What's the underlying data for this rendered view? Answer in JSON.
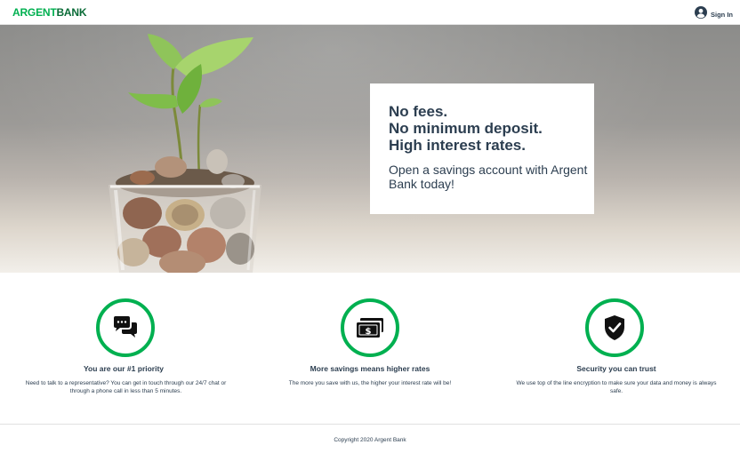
{
  "nav": {
    "brand_first": "ARGENT",
    "brand_second": "BANK",
    "sign_in_label": "Sign In",
    "icons": {
      "user": "user-circle-icon"
    }
  },
  "hero": {
    "headline_line1": "No fees.",
    "headline_line2": "No minimum deposit.",
    "headline_line3": "High interest rates.",
    "subheadline": "Open a savings account with Argent Bank today!"
  },
  "features": [
    {
      "icon": "chat-icon",
      "title": "You are our #1 priority",
      "text": "Need to talk to a representative? You can get in touch through our 24/7 chat or through a phone call in less than 5 minutes."
    },
    {
      "icon": "money-icon",
      "title": "More savings means higher rates",
      "text": "The more you save with us, the higher your interest rate will be!"
    },
    {
      "icon": "security-icon",
      "title": "Security you can trust",
      "text": "We use top of the line encryption to make sure your data and money is always safe."
    }
  ],
  "footer": {
    "copyright": "Copyright 2020 Argent Bank"
  },
  "colors": {
    "accent": "#00b050",
    "brand_dark": "#0a6b37",
    "text": "#2c3e50"
  }
}
